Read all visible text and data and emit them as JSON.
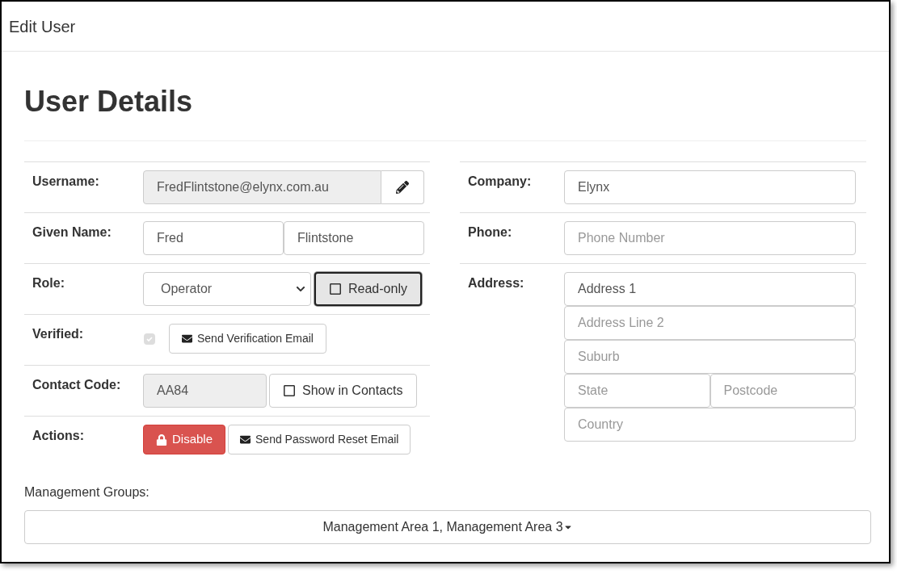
{
  "window": {
    "title": "Edit User"
  },
  "heading": "User Details",
  "username": {
    "label": "Username:",
    "value": "FredFlintstone@elynx.com.au",
    "readonly": true
  },
  "given_name": {
    "label": "Given Name:",
    "first": "Fred",
    "last": "Flintstone"
  },
  "role": {
    "label": "Role:",
    "value": "Operator",
    "toggle": {
      "label": "Read-only",
      "checked": false,
      "focused": true
    }
  },
  "verified": {
    "label": "Verified:",
    "checked": true,
    "disabled": true,
    "button": "Send Verification Email"
  },
  "contact_code": {
    "label": "Contact Code:",
    "value": "AA84",
    "readonly": true,
    "toggle": {
      "label": "Show in Contacts",
      "checked": false,
      "focused": false
    }
  },
  "actions": {
    "label": "Actions:",
    "buttons": [
      {
        "label": "Disable",
        "kind": "danger"
      },
      {
        "label": "Send Password Reset Email",
        "kind": "email"
      }
    ]
  },
  "company": {
    "label": "Company:",
    "value": "Elynx"
  },
  "phone": {
    "label": "Phone:",
    "placeholder": "Phone Number"
  },
  "address": {
    "label": "Address:",
    "lines": [
      {
        "fields": [
          {
            "value": "Address 1"
          }
        ]
      },
      {
        "fields": [
          {
            "placeholder": "Address Line 2"
          }
        ]
      },
      {
        "fields": [
          {
            "placeholder": "Suburb"
          }
        ]
      },
      {
        "fields": [
          {
            "placeholder": "State"
          },
          {
            "placeholder": "Postcode"
          }
        ]
      },
      {
        "fields": [
          {
            "placeholder": "Country"
          }
        ]
      }
    ]
  },
  "management_groups": {
    "label": "Management Groups:",
    "value": "Management Area 1, Management Area 3"
  }
}
